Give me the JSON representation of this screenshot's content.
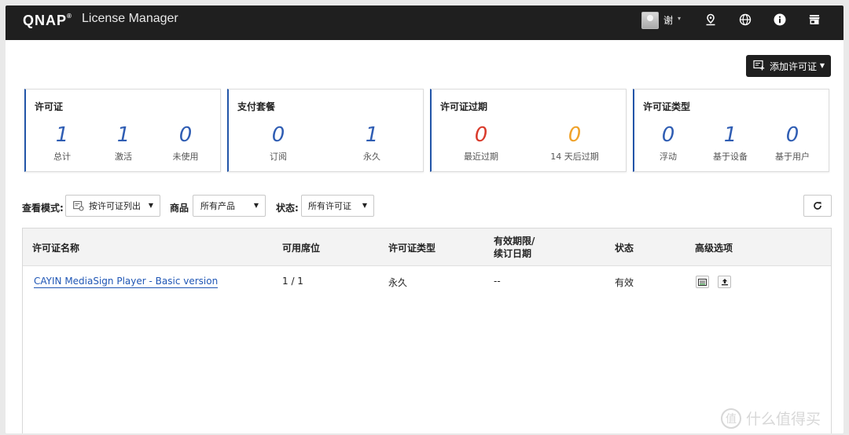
{
  "topbar": {
    "logo": "QNAP",
    "logo_reg": "®",
    "app_title": "License Manager",
    "user_name": "谢",
    "user_caret": "▾"
  },
  "add_button": {
    "label": "添加许可证",
    "caret": "▼"
  },
  "cards": {
    "license": {
      "title": "许可证",
      "stats": [
        {
          "value": "1",
          "label": "总计"
        },
        {
          "value": "1",
          "label": "激活"
        },
        {
          "value": "0",
          "label": "未使用"
        }
      ]
    },
    "plan": {
      "title": "支付套餐",
      "stats": [
        {
          "value": "0",
          "label": "订阅"
        },
        {
          "value": "1",
          "label": "永久"
        }
      ]
    },
    "expiry": {
      "title": "许可证过期",
      "stats": [
        {
          "value": "0",
          "label": "最近过期"
        },
        {
          "value": "0",
          "label": "14 天后过期"
        }
      ]
    },
    "type": {
      "title": "许可证类型",
      "stats": [
        {
          "value": "0",
          "label": "浮动"
        },
        {
          "value": "1",
          "label": "基于设备"
        },
        {
          "value": "0",
          "label": "基于用户"
        }
      ]
    }
  },
  "filters": {
    "view_mode_label": "查看模式:",
    "view_mode_value": "按许可证列出",
    "product_label": "商品",
    "product_value": "所有产品",
    "status_label": "状态:",
    "status_value": "所有许可证",
    "caret": "▼"
  },
  "table": {
    "headers": {
      "name": "许可证名称",
      "seats": "可用席位",
      "type": "许可证类型",
      "expiry_line1": "有效期限/",
      "expiry_line2": "续订日期",
      "status": "状态",
      "advanced": "高级选项"
    },
    "rows": [
      {
        "name": "CAYIN MediaSign Player - Basic version",
        "seats": "1 / 1",
        "type": "永久",
        "expiry": "--",
        "status": "有效"
      }
    ]
  },
  "watermark": {
    "glyph": "值",
    "text": "什么值得买"
  },
  "colors": {
    "topbar": "#1f1f1f",
    "accent_blue": "#2f5db3",
    "link_blue": "#1f56b5",
    "alert_red": "#d93a2b",
    "warn_orange": "#f0a22a"
  }
}
